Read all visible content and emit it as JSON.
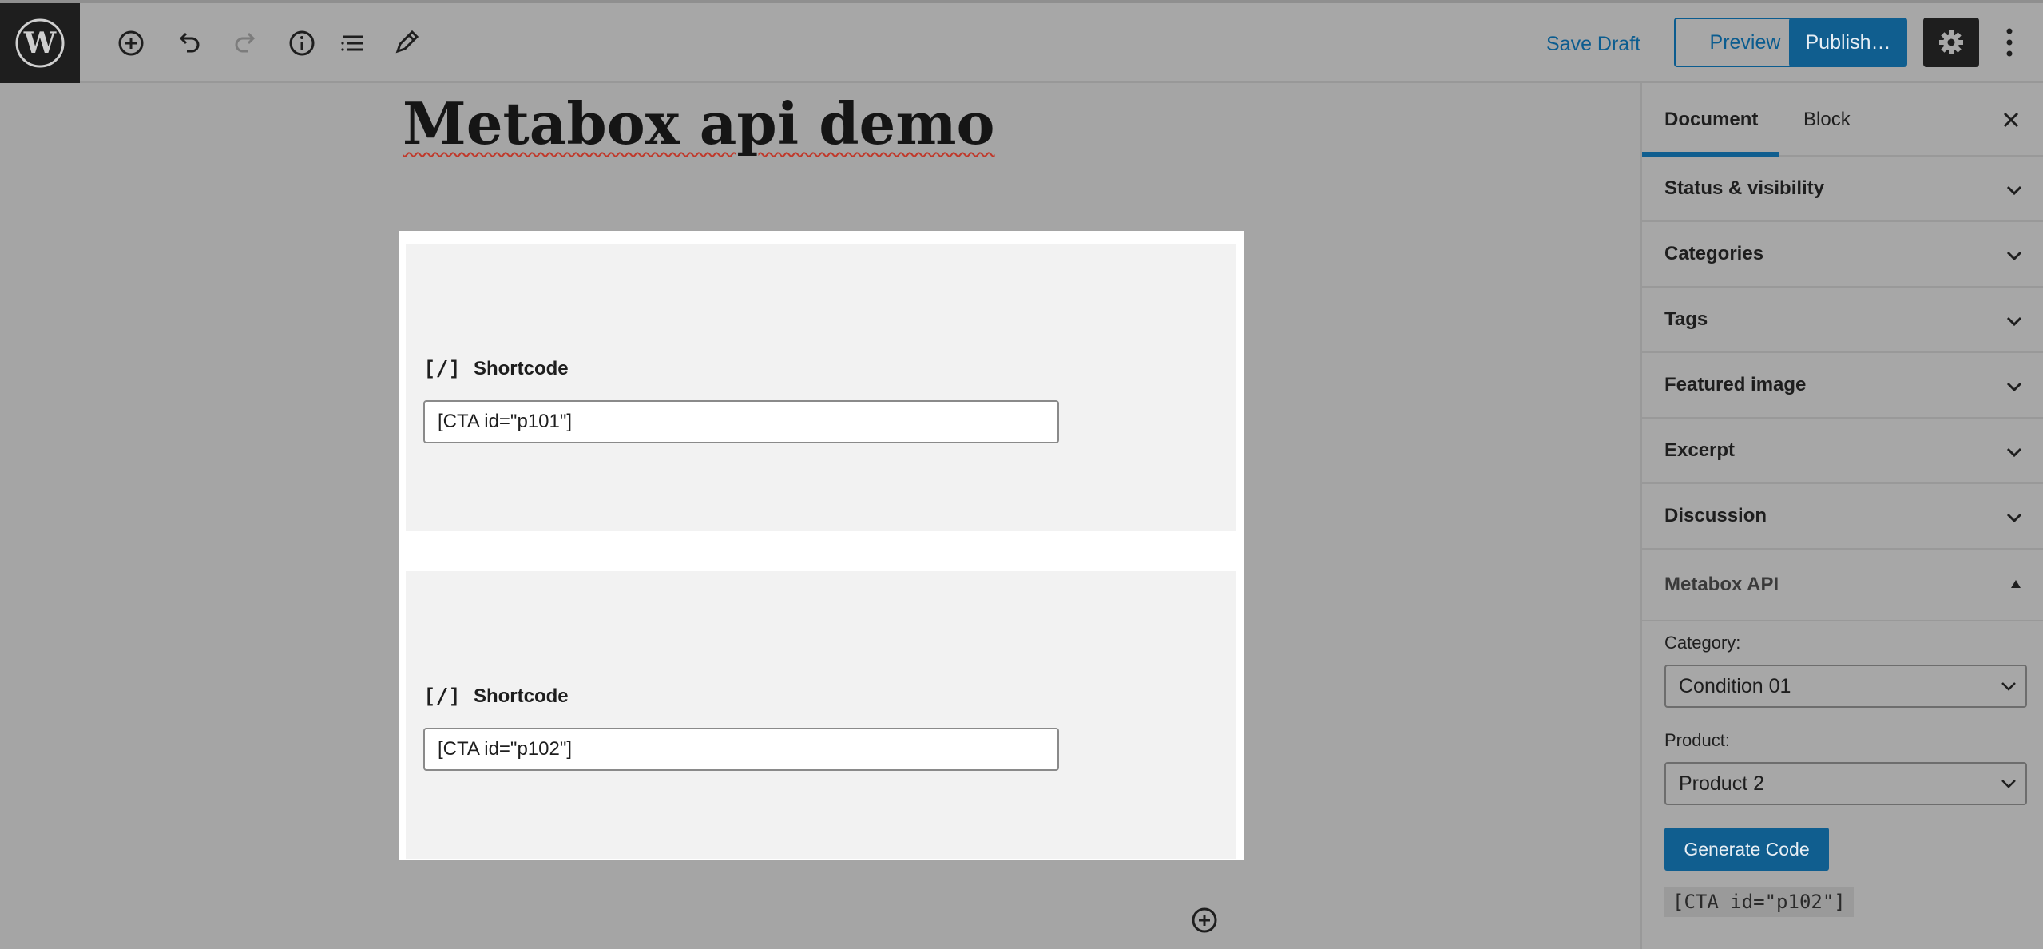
{
  "topbar": {
    "icons": [
      "wordpress-logo",
      "add-block-icon",
      "undo-icon",
      "redo-icon",
      "info-icon",
      "outline-icon",
      "edit-tools-icon"
    ],
    "save_draft": "Save Draft",
    "preview": "Preview",
    "publish": "Publish…",
    "settings_icon": "gear-icon",
    "more_icon": "more-vertical-icon"
  },
  "editor": {
    "title": "Metabox api demo",
    "blocks": [
      {
        "type": "Shortcode",
        "icon": "[/]",
        "value": "[CTA id=\"p101\"]"
      },
      {
        "type": "Shortcode",
        "icon": "[/]",
        "value": "[CTA id=\"p102\"]"
      }
    ]
  },
  "sidebar": {
    "tabs": [
      "Document",
      "Block"
    ],
    "active_tab": "Document",
    "panels": [
      "Status & visibility",
      "Categories",
      "Tags",
      "Featured image",
      "Excerpt",
      "Discussion"
    ],
    "metabox": {
      "title": "Metabox API",
      "category_label": "Category:",
      "category_value": "Condition 01",
      "product_label": "Product:",
      "product_value": "Product 2",
      "button": "Generate Code",
      "output": "[CTA id=\"p102\"]"
    }
  },
  "colors": {
    "accent": "#105e8f",
    "overlay": "#a5a5a5"
  }
}
